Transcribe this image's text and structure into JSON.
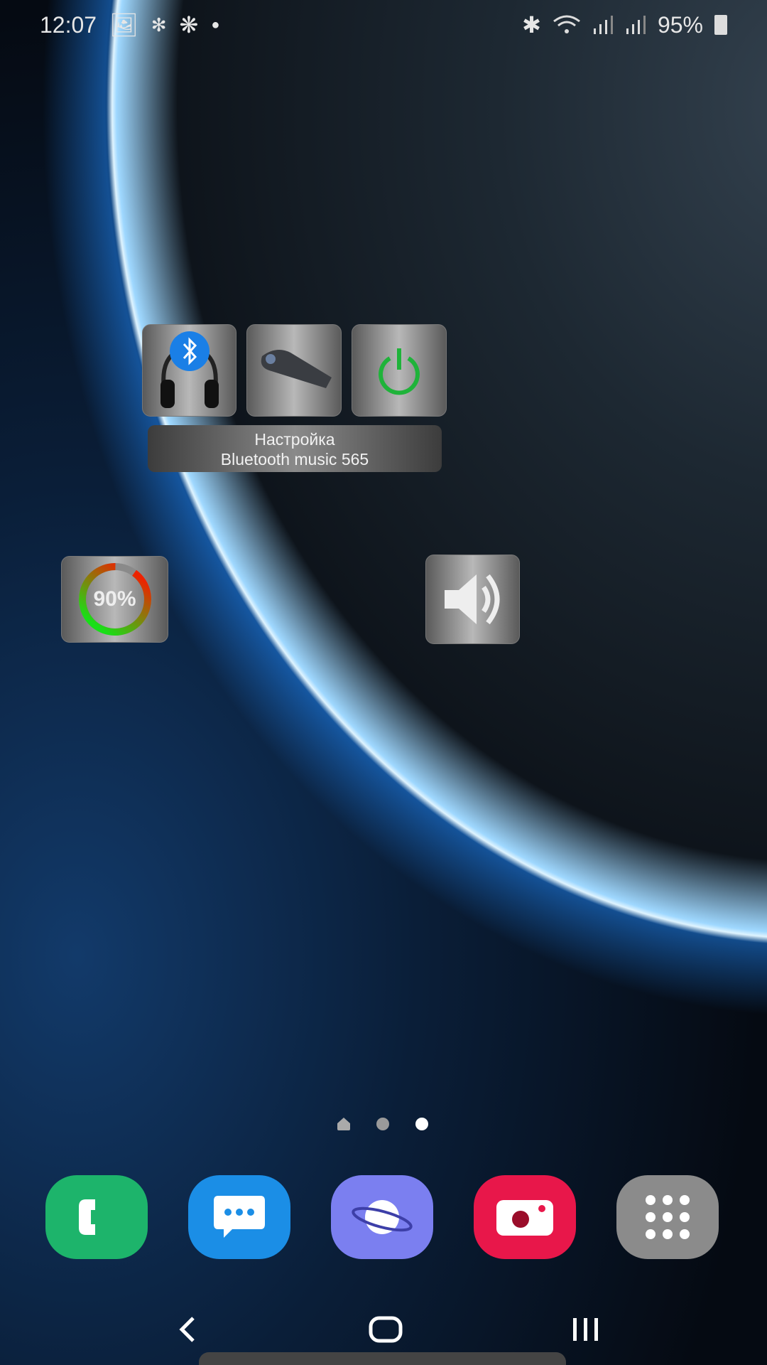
{
  "status_bar": {
    "time": "12:07",
    "notification_icons": [
      "image-icon",
      "bluetooth-settings-icon",
      "network-hub-icon",
      "dot-icon"
    ],
    "system_icons": [
      "bluetooth-icon",
      "wifi-icon",
      "signal-icon",
      "signal-icon"
    ],
    "battery": "95%"
  },
  "widget": {
    "title_line1": "Настройка",
    "title_line2": "Bluetooth music 565",
    "buttons": [
      "bluetooth-headphones",
      "headset",
      "power"
    ],
    "power_color": "#1fb33a",
    "battery_level": "90%",
    "battery_fraction": 0.9
  },
  "home": {
    "page_count": 3,
    "active_page": 3
  },
  "dock": [
    {
      "name": "Phone",
      "color": "#1db46b"
    },
    {
      "name": "Messages",
      "color": "#1b8ee6"
    },
    {
      "name": "Internet",
      "color": "#7b7ff0"
    },
    {
      "name": "Camera",
      "color": "#e8174a"
    },
    {
      "name": "Apps",
      "color": "#8b8b8b"
    }
  ],
  "nav": [
    "back",
    "home",
    "recents"
  ]
}
